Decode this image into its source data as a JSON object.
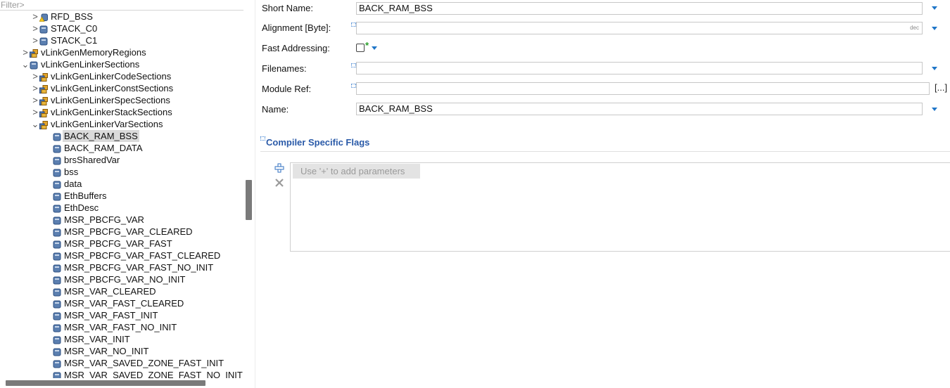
{
  "filter": {
    "placeholder": "Filter>",
    "value": ""
  },
  "tree": [
    {
      "label": "RFD_BSS",
      "twisty": ">",
      "icon": "warning-module-icon",
      "selected": false
    },
    {
      "label": "STACK_C0",
      "twisty": ">",
      "icon": "module-icon",
      "selected": false
    },
    {
      "label": "STACK_C1",
      "twisty": ">",
      "icon": "module-icon",
      "selected": false
    },
    {
      "label": "vLinkGenMemoryRegions",
      "twisty": ">",
      "icon": "container-icon",
      "selected": false
    },
    {
      "label": "vLinkGenLinkerSections",
      "twisty": "⌄",
      "icon": "module-icon",
      "selected": false
    },
    {
      "label": "vLinkGenLinkerCodeSections",
      "twisty": ">",
      "icon": "container-icon",
      "selected": false
    },
    {
      "label": "vLinkGenLinkerConstSections",
      "twisty": ">",
      "icon": "container-icon",
      "selected": false
    },
    {
      "label": "vLinkGenLinkerSpecSections",
      "twisty": ">",
      "icon": "container-icon",
      "selected": false
    },
    {
      "label": "vLinkGenLinkerStackSections",
      "twisty": ">",
      "icon": "container-icon",
      "selected": false
    },
    {
      "label": "vLinkGenLinkerVarSections",
      "twisty": "⌄",
      "icon": "container-icon",
      "selected": false
    },
    {
      "label": "BACK_RAM_BSS",
      "twisty": "",
      "icon": "module-icon",
      "selected": true
    },
    {
      "label": "BACK_RAM_DATA",
      "twisty": "",
      "icon": "module-icon",
      "selected": false
    },
    {
      "label": "brsSharedVar",
      "twisty": "",
      "icon": "module-icon",
      "selected": false
    },
    {
      "label": "bss",
      "twisty": "",
      "icon": "module-icon",
      "selected": false
    },
    {
      "label": "data",
      "twisty": "",
      "icon": "module-icon",
      "selected": false
    },
    {
      "label": "EthBuffers",
      "twisty": "",
      "icon": "module-icon",
      "selected": false
    },
    {
      "label": "EthDesc",
      "twisty": "",
      "icon": "module-icon",
      "selected": false
    },
    {
      "label": "MSR_PBCFG_VAR",
      "twisty": "",
      "icon": "module-icon",
      "selected": false
    },
    {
      "label": "MSR_PBCFG_VAR_CLEARED",
      "twisty": "",
      "icon": "module-icon",
      "selected": false
    },
    {
      "label": "MSR_PBCFG_VAR_FAST",
      "twisty": "",
      "icon": "module-icon",
      "selected": false
    },
    {
      "label": "MSR_PBCFG_VAR_FAST_CLEARED",
      "twisty": "",
      "icon": "module-icon",
      "selected": false
    },
    {
      "label": "MSR_PBCFG_VAR_FAST_NO_INIT",
      "twisty": "",
      "icon": "module-icon",
      "selected": false
    },
    {
      "label": "MSR_PBCFG_VAR_NO_INIT",
      "twisty": "",
      "icon": "module-icon",
      "selected": false
    },
    {
      "label": "MSR_VAR_CLEARED",
      "twisty": "",
      "icon": "module-icon",
      "selected": false
    },
    {
      "label": "MSR_VAR_FAST_CLEARED",
      "twisty": "",
      "icon": "module-icon",
      "selected": false
    },
    {
      "label": "MSR_VAR_FAST_INIT",
      "twisty": "",
      "icon": "module-icon",
      "selected": false
    },
    {
      "label": "MSR_VAR_FAST_NO_INIT",
      "twisty": "",
      "icon": "module-icon",
      "selected": false
    },
    {
      "label": "MSR_VAR_INIT",
      "twisty": "",
      "icon": "module-icon",
      "selected": false
    },
    {
      "label": "MSR_VAR_NO_INIT",
      "twisty": "",
      "icon": "module-icon",
      "selected": false
    },
    {
      "label": "MSR_VAR_SAVED_ZONE_FAST_INIT",
      "twisty": "",
      "icon": "module-icon",
      "selected": false
    },
    {
      "label": "MSR_VAR_SAVED_ZONE_FAST_NO_INIT",
      "twisty": "",
      "icon": "module-icon",
      "selected": false
    }
  ],
  "form": {
    "short_name": {
      "label": "Short Name:",
      "value": "BACK_RAM_BSS"
    },
    "alignment": {
      "label": "Alignment [Byte]:",
      "value": "",
      "unit": "dec"
    },
    "fast_addressing": {
      "label": "Fast Addressing:",
      "checked": false,
      "star": "*"
    },
    "filenames": {
      "label": "Filenames:",
      "value": ""
    },
    "module_ref": {
      "label": "Module Ref:",
      "value": "",
      "browse_label": "[...]"
    },
    "name": {
      "label": "Name:",
      "value": "BACK_RAM_BSS"
    }
  },
  "compiler_flags": {
    "title": "Compiler Specific Flags",
    "hint": "Use '+' to add parameters",
    "add_icon": "plus-icon",
    "remove_icon": "remove-icon"
  },
  "colors": {
    "accent": "#1f76c8",
    "section_title": "#2a5aa8",
    "selection": "#dadada",
    "star": "#2aa02a"
  }
}
